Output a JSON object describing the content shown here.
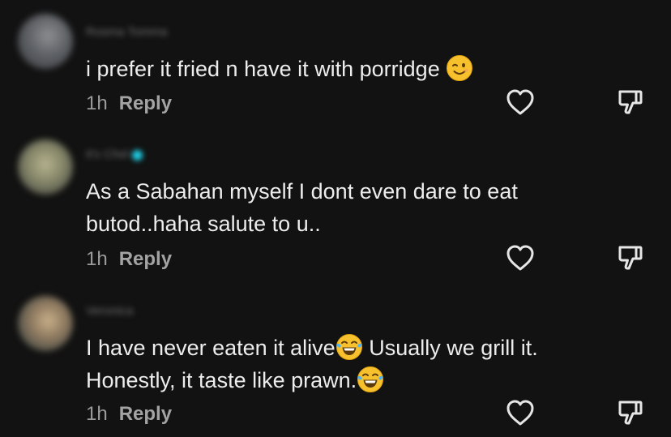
{
  "comments": [
    {
      "username": "Rosma Tomma",
      "verified": false,
      "text_before": "i prefer it fried n have it with porridge ",
      "emoji_1": "winking-face",
      "text_line2": "",
      "emoji_2": "",
      "time": "1h",
      "reply_label": "Reply",
      "like_icon": "heart-outline-icon",
      "dislike_icon": "thumbs-down-icon"
    },
    {
      "username": "it's Chel",
      "verified": true,
      "line1": "As a Sabahan myself I dont even dare to eat",
      "line2": "butod..haha salute to u..",
      "time": "1h",
      "reply_label": "Reply",
      "like_icon": "heart-outline-icon",
      "dislike_icon": "thumbs-down-icon"
    },
    {
      "username": "Veronica",
      "verified": false,
      "line1_before": "I have never eaten it alive",
      "line1_emoji": "face-with-tears-of-joy",
      "line1_after": " Usually we grill it.",
      "line2_before": "Honestly, it taste like prawn.",
      "line2_emoji": "face-with-tears-of-joy",
      "time": "1h",
      "reply_label": "Reply",
      "like_icon": "heart-outline-icon",
      "dislike_icon": "thumbs-down-icon"
    }
  ],
  "colors": {
    "background": "#121212",
    "text": "#ededed",
    "muted": "#9b9b9b",
    "icon": "#e6e6e6"
  }
}
